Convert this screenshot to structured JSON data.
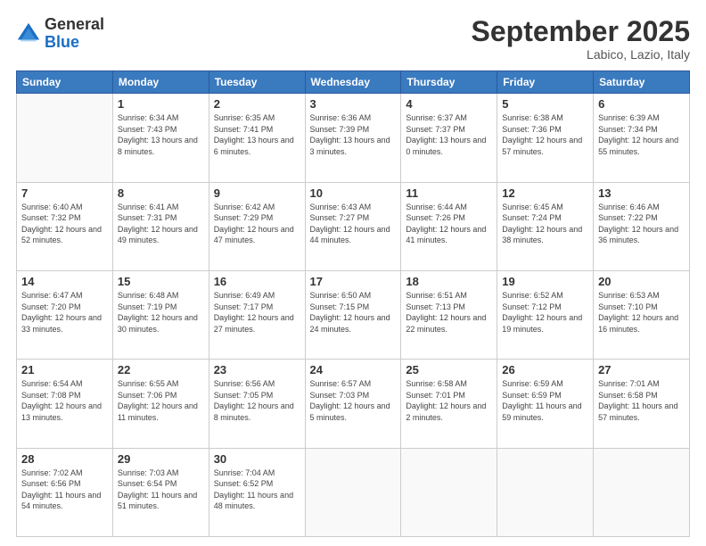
{
  "logo": {
    "general": "General",
    "blue": "Blue"
  },
  "header": {
    "title": "September 2025",
    "location": "Labico, Lazio, Italy"
  },
  "weekdays": [
    "Sunday",
    "Monday",
    "Tuesday",
    "Wednesday",
    "Thursday",
    "Friday",
    "Saturday"
  ],
  "weeks": [
    [
      {
        "day": "",
        "empty": true
      },
      {
        "day": "1",
        "sunrise": "Sunrise: 6:34 AM",
        "sunset": "Sunset: 7:43 PM",
        "daylight": "Daylight: 13 hours and 8 minutes."
      },
      {
        "day": "2",
        "sunrise": "Sunrise: 6:35 AM",
        "sunset": "Sunset: 7:41 PM",
        "daylight": "Daylight: 13 hours and 6 minutes."
      },
      {
        "day": "3",
        "sunrise": "Sunrise: 6:36 AM",
        "sunset": "Sunset: 7:39 PM",
        "daylight": "Daylight: 13 hours and 3 minutes."
      },
      {
        "day": "4",
        "sunrise": "Sunrise: 6:37 AM",
        "sunset": "Sunset: 7:37 PM",
        "daylight": "Daylight: 13 hours and 0 minutes."
      },
      {
        "day": "5",
        "sunrise": "Sunrise: 6:38 AM",
        "sunset": "Sunset: 7:36 PM",
        "daylight": "Daylight: 12 hours and 57 minutes."
      },
      {
        "day": "6",
        "sunrise": "Sunrise: 6:39 AM",
        "sunset": "Sunset: 7:34 PM",
        "daylight": "Daylight: 12 hours and 55 minutes."
      }
    ],
    [
      {
        "day": "7",
        "sunrise": "Sunrise: 6:40 AM",
        "sunset": "Sunset: 7:32 PM",
        "daylight": "Daylight: 12 hours and 52 minutes."
      },
      {
        "day": "8",
        "sunrise": "Sunrise: 6:41 AM",
        "sunset": "Sunset: 7:31 PM",
        "daylight": "Daylight: 12 hours and 49 minutes."
      },
      {
        "day": "9",
        "sunrise": "Sunrise: 6:42 AM",
        "sunset": "Sunset: 7:29 PM",
        "daylight": "Daylight: 12 hours and 47 minutes."
      },
      {
        "day": "10",
        "sunrise": "Sunrise: 6:43 AM",
        "sunset": "Sunset: 7:27 PM",
        "daylight": "Daylight: 12 hours and 44 minutes."
      },
      {
        "day": "11",
        "sunrise": "Sunrise: 6:44 AM",
        "sunset": "Sunset: 7:26 PM",
        "daylight": "Daylight: 12 hours and 41 minutes."
      },
      {
        "day": "12",
        "sunrise": "Sunrise: 6:45 AM",
        "sunset": "Sunset: 7:24 PM",
        "daylight": "Daylight: 12 hours and 38 minutes."
      },
      {
        "day": "13",
        "sunrise": "Sunrise: 6:46 AM",
        "sunset": "Sunset: 7:22 PM",
        "daylight": "Daylight: 12 hours and 36 minutes."
      }
    ],
    [
      {
        "day": "14",
        "sunrise": "Sunrise: 6:47 AM",
        "sunset": "Sunset: 7:20 PM",
        "daylight": "Daylight: 12 hours and 33 minutes."
      },
      {
        "day": "15",
        "sunrise": "Sunrise: 6:48 AM",
        "sunset": "Sunset: 7:19 PM",
        "daylight": "Daylight: 12 hours and 30 minutes."
      },
      {
        "day": "16",
        "sunrise": "Sunrise: 6:49 AM",
        "sunset": "Sunset: 7:17 PM",
        "daylight": "Daylight: 12 hours and 27 minutes."
      },
      {
        "day": "17",
        "sunrise": "Sunrise: 6:50 AM",
        "sunset": "Sunset: 7:15 PM",
        "daylight": "Daylight: 12 hours and 24 minutes."
      },
      {
        "day": "18",
        "sunrise": "Sunrise: 6:51 AM",
        "sunset": "Sunset: 7:13 PM",
        "daylight": "Daylight: 12 hours and 22 minutes."
      },
      {
        "day": "19",
        "sunrise": "Sunrise: 6:52 AM",
        "sunset": "Sunset: 7:12 PM",
        "daylight": "Daylight: 12 hours and 19 minutes."
      },
      {
        "day": "20",
        "sunrise": "Sunrise: 6:53 AM",
        "sunset": "Sunset: 7:10 PM",
        "daylight": "Daylight: 12 hours and 16 minutes."
      }
    ],
    [
      {
        "day": "21",
        "sunrise": "Sunrise: 6:54 AM",
        "sunset": "Sunset: 7:08 PM",
        "daylight": "Daylight: 12 hours and 13 minutes."
      },
      {
        "day": "22",
        "sunrise": "Sunrise: 6:55 AM",
        "sunset": "Sunset: 7:06 PM",
        "daylight": "Daylight: 12 hours and 11 minutes."
      },
      {
        "day": "23",
        "sunrise": "Sunrise: 6:56 AM",
        "sunset": "Sunset: 7:05 PM",
        "daylight": "Daylight: 12 hours and 8 minutes."
      },
      {
        "day": "24",
        "sunrise": "Sunrise: 6:57 AM",
        "sunset": "Sunset: 7:03 PM",
        "daylight": "Daylight: 12 hours and 5 minutes."
      },
      {
        "day": "25",
        "sunrise": "Sunrise: 6:58 AM",
        "sunset": "Sunset: 7:01 PM",
        "daylight": "Daylight: 12 hours and 2 minutes."
      },
      {
        "day": "26",
        "sunrise": "Sunrise: 6:59 AM",
        "sunset": "Sunset: 6:59 PM",
        "daylight": "Daylight: 11 hours and 59 minutes."
      },
      {
        "day": "27",
        "sunrise": "Sunrise: 7:01 AM",
        "sunset": "Sunset: 6:58 PM",
        "daylight": "Daylight: 11 hours and 57 minutes."
      }
    ],
    [
      {
        "day": "28",
        "sunrise": "Sunrise: 7:02 AM",
        "sunset": "Sunset: 6:56 PM",
        "daylight": "Daylight: 11 hours and 54 minutes."
      },
      {
        "day": "29",
        "sunrise": "Sunrise: 7:03 AM",
        "sunset": "Sunset: 6:54 PM",
        "daylight": "Daylight: 11 hours and 51 minutes."
      },
      {
        "day": "30",
        "sunrise": "Sunrise: 7:04 AM",
        "sunset": "Sunset: 6:52 PM",
        "daylight": "Daylight: 11 hours and 48 minutes."
      },
      {
        "day": "",
        "empty": true
      },
      {
        "day": "",
        "empty": true
      },
      {
        "day": "",
        "empty": true
      },
      {
        "day": "",
        "empty": true
      }
    ]
  ]
}
